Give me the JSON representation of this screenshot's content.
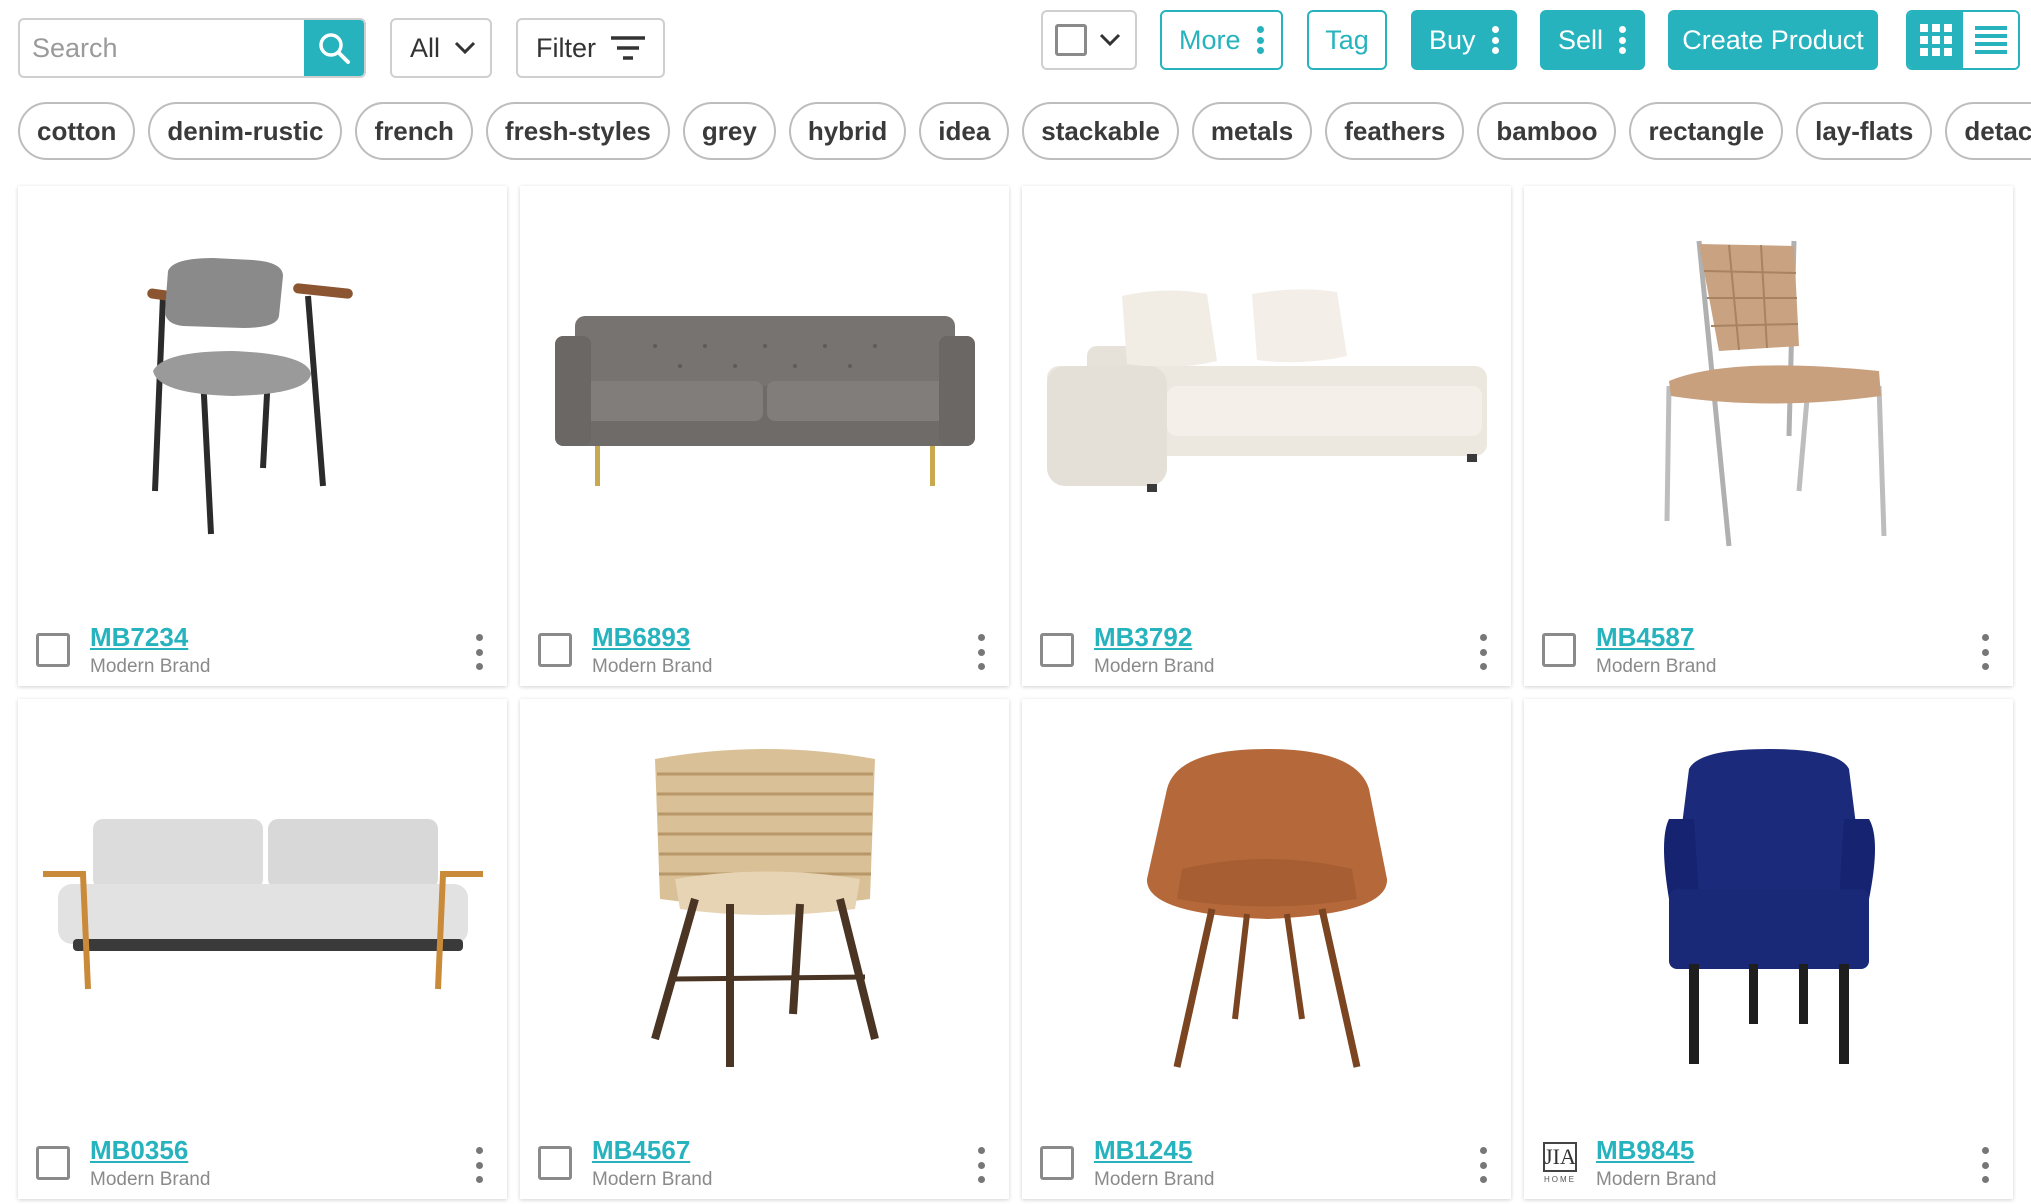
{
  "colors": {
    "accent": "#27b3be",
    "border": "#cfcfcf",
    "text": "#333333",
    "muted": "#8a8a8a"
  },
  "toolbar": {
    "search_placeholder": "Search",
    "scope_select": "All",
    "filter_label": "Filter",
    "more_label": "More",
    "tag_label": "Tag",
    "buy_label": "Buy",
    "sell_label": "Sell",
    "create_label": "Create Product",
    "view_mode": "grid"
  },
  "tags": [
    "cotton",
    "denim-rustic",
    "french",
    "fresh-styles",
    "grey",
    "hybrid",
    "idea",
    "stackable",
    "metals",
    "feathers",
    "bamboo",
    "rectangle",
    "lay-flats",
    "detached"
  ],
  "products": [
    {
      "sku": "MB7234",
      "brand": "Modern Brand",
      "image": "grey-armchair-metal-frame"
    },
    {
      "sku": "MB6893",
      "brand": "Modern Brand",
      "image": "grey-tufted-sofa"
    },
    {
      "sku": "MB3792",
      "brand": "Modern Brand",
      "image": "cream-chaise-sofa"
    },
    {
      "sku": "MB4587",
      "brand": "Modern Brand",
      "image": "woven-leather-dining-chair"
    },
    {
      "sku": "MB0356",
      "brand": "Modern Brand",
      "image": "light-grey-sofa-wood-frame"
    },
    {
      "sku": "MB4567",
      "brand": "Modern Brand",
      "image": "rattan-barrel-chair"
    },
    {
      "sku": "MB1245",
      "brand": "Modern Brand",
      "image": "tan-leather-shell-chair"
    },
    {
      "sku": "MB9845",
      "brand": "Modern Brand",
      "image": "navy-velvet-wingback-chair",
      "logo": "JIA",
      "logo_sub": "HOME"
    }
  ]
}
